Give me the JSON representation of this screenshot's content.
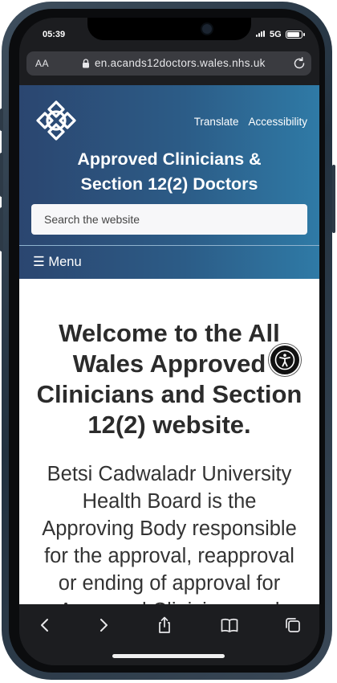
{
  "status_bar": {
    "time": "05:39",
    "network": "5G"
  },
  "browser": {
    "text_size_label": "AA",
    "url": "en.acands12doctors.wales.nhs.uk"
  },
  "site": {
    "header_links": {
      "translate": "Translate",
      "accessibility": "Accessibility"
    },
    "title_line1": "Approved Clinicians &",
    "title_line2": "Section 12(2) Doctors",
    "search_placeholder": "Search the website",
    "menu_label": "☰ Menu"
  },
  "content": {
    "welcome_lines": [
      "Welcome to the All",
      "Wales Approved",
      "Clinicians and Section",
      "12(2) website."
    ],
    "intro_lines": [
      "Betsi Cadwaladr University",
      "Health Board is the",
      "Approving Body responsible",
      "for the approval, reapproval",
      "or ending of approval for",
      "Approved Clinicians and"
    ]
  },
  "colors": {
    "header_gradient_start": "#2b4670",
    "header_gradient_end": "#2f7aa6",
    "toolbar": "#1c1d20"
  },
  "icons": {
    "lock": "lock-icon",
    "reload": "reload-icon",
    "logo": "celtic-knot-logo",
    "accessibility": "accessibility-person-icon",
    "back": "chevron-left-icon",
    "forward": "chevron-right-icon",
    "share": "share-icon",
    "bookmarks": "book-icon",
    "tabs": "tabs-icon"
  }
}
